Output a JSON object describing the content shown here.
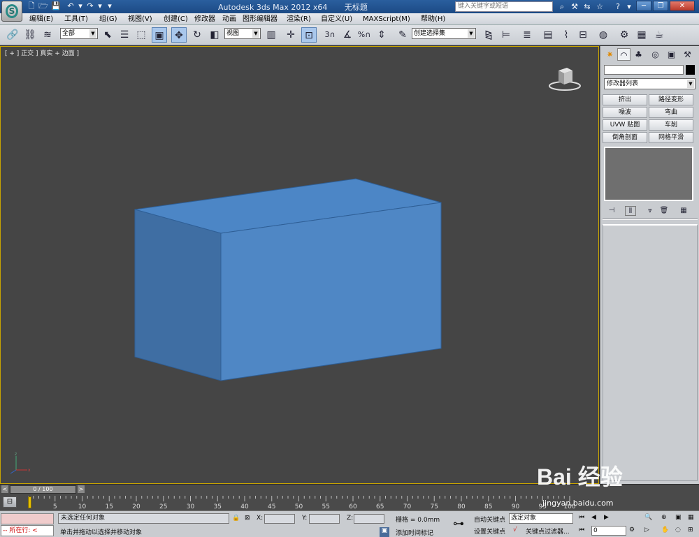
{
  "app": {
    "title": "Autodesk 3ds Max  2012 x64",
    "doc_title": "无标题",
    "search_placeholder": "键入关键字或短语"
  },
  "menus": [
    "编辑(E)",
    "工具(T)",
    "组(G)",
    "视图(V)",
    "创建(C)",
    "修改器",
    "动画",
    "图形编辑器",
    "渲染(R)",
    "自定义(U)",
    "MAXScript(M)",
    "帮助(H)"
  ],
  "toolbar": {
    "selection_filter": "全部",
    "reference_coord": "视图",
    "named_selection": "创建选择集",
    "snap_angle_label": "3",
    "percent_snap_label": "%"
  },
  "viewport": {
    "label": "[ + ] 正交 ] 真实 + 边面 ]",
    "box_color": "#4f87c5",
    "border_color": "#c8a400"
  },
  "command_panel": {
    "modifier_list": "修改器列表",
    "modifier_buttons": [
      "挤出",
      "路径变形",
      "噪波",
      "弯曲",
      "UVW 贴图",
      "车削",
      "倒角剖面",
      "网格平滑"
    ]
  },
  "timeline": {
    "slider_label": "0 / 100",
    "ticks": [
      "0",
      "5",
      "10",
      "15",
      "20",
      "25",
      "30",
      "35",
      "40",
      "45",
      "50",
      "55",
      "60",
      "65",
      "70",
      "75",
      "80",
      "85",
      "90",
      "95",
      "100"
    ]
  },
  "status": {
    "running_label": "所在行:",
    "selection_info": "未选定任何对象",
    "prompt": "单击并拖动以选择并移动对象",
    "x_label": "X:",
    "y_label": "Y:",
    "z_label": "Z:",
    "grid": "栅格 = 0.0mm",
    "add_time_tag": "添加时间标记",
    "auto_key": "自动关键点",
    "set_key": "设置关键点",
    "selected_object": "选定对象",
    "key_filters": "关键点过滤器...",
    "frame": "0"
  },
  "watermark": {
    "brand": "Bai 经验",
    "url": "jingyan.baidu.com"
  }
}
